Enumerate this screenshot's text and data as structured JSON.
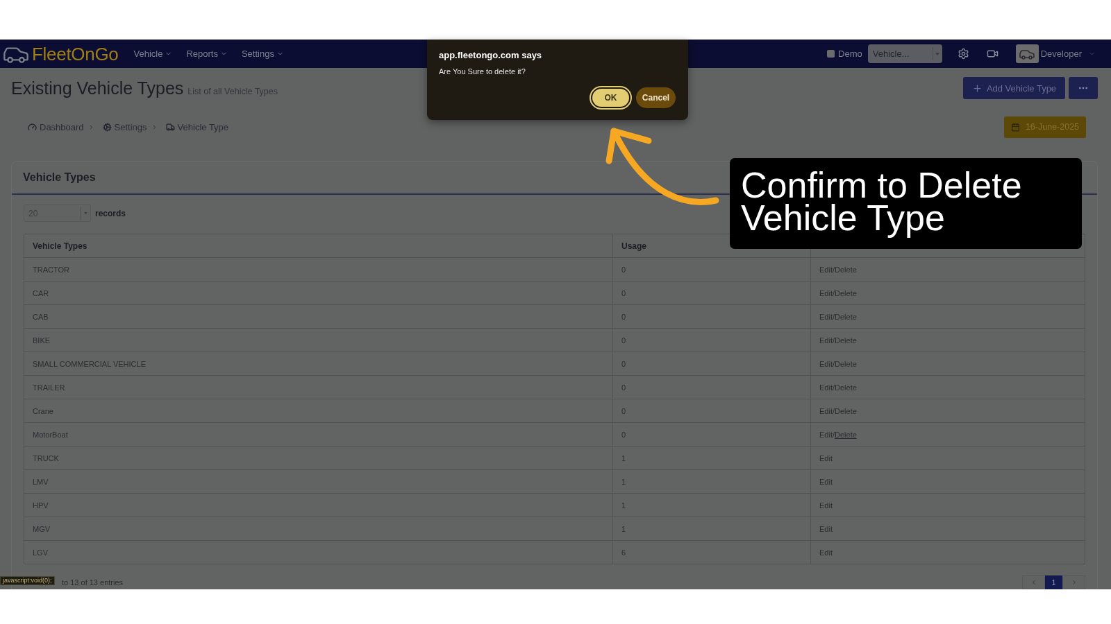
{
  "nav": {
    "logo": "FleetOnGo",
    "menu": [
      {
        "label": "Vehicle"
      },
      {
        "label": "Reports"
      },
      {
        "label": "Settings"
      }
    ],
    "demo": {
      "label": "Demo",
      "checked": false
    },
    "vehicle_select": {
      "value": "Vehicle..."
    },
    "user": {
      "name": "Developer"
    }
  },
  "header": {
    "title": "Existing Vehicle Types",
    "subtitle": "List of all Vehicle Types",
    "add_button": "Add Vehicle Type"
  },
  "breadcrumb": [
    {
      "kind": "dashboard",
      "label": "Dashboard"
    },
    {
      "kind": "settings",
      "label": "Settings"
    },
    {
      "kind": "vehicle",
      "label": "Vehicle Type"
    }
  ],
  "date_button": "16-June-2025",
  "section": {
    "title": "Vehicle Types",
    "page_size": "20",
    "page_size_label": "records"
  },
  "table": {
    "columns": [
      "Vehicle Types",
      "Usage"
    ],
    "rows": [
      {
        "name": "TRACTOR",
        "usage": "0",
        "separator": "/",
        "actions": [
          {
            "label": "Edit",
            "hovered": false
          },
          {
            "label": "Delete",
            "hovered": false
          }
        ]
      },
      {
        "name": "CAR",
        "usage": "0",
        "separator": "/",
        "actions": [
          {
            "label": "Edit",
            "hovered": false
          },
          {
            "label": "Delete",
            "hovered": false
          }
        ]
      },
      {
        "name": "CAB",
        "usage": "0",
        "separator": "/",
        "actions": [
          {
            "label": "Edit",
            "hovered": false
          },
          {
            "label": "Delete",
            "hovered": false
          }
        ]
      },
      {
        "name": "BIKE",
        "usage": "0",
        "separator": "/",
        "actions": [
          {
            "label": "Edit",
            "hovered": false
          },
          {
            "label": "Delete",
            "hovered": false
          }
        ]
      },
      {
        "name": "SMALL COMMERCIAL VEHICLE",
        "usage": "0",
        "separator": "/",
        "actions": [
          {
            "label": "Edit",
            "hovered": false
          },
          {
            "label": "Delete",
            "hovered": false
          }
        ]
      },
      {
        "name": "TRAILER",
        "usage": "0",
        "separator": "/",
        "actions": [
          {
            "label": "Edit",
            "hovered": false
          },
          {
            "label": "Delete",
            "hovered": false
          }
        ]
      },
      {
        "name": "Crane",
        "usage": "0",
        "separator": "/",
        "actions": [
          {
            "label": "Edit",
            "hovered": false
          },
          {
            "label": "Delete",
            "hovered": false
          }
        ]
      },
      {
        "name": "MotorBoat",
        "usage": "0",
        "separator": "/",
        "actions": [
          {
            "label": "Edit",
            "hovered": false
          },
          {
            "label": "Delete",
            "hovered": true
          }
        ]
      },
      {
        "name": "TRUCK",
        "usage": "1",
        "actions": [
          {
            "label": "Edit",
            "hovered": false
          }
        ]
      },
      {
        "name": "LMV",
        "usage": "1",
        "actions": [
          {
            "label": "Edit",
            "hovered": false
          }
        ]
      },
      {
        "name": "HPV",
        "usage": "1",
        "actions": [
          {
            "label": "Edit",
            "hovered": false
          }
        ]
      },
      {
        "name": "MGV",
        "usage": "1",
        "actions": [
          {
            "label": "Edit",
            "hovered": false
          }
        ]
      },
      {
        "name": "LGV",
        "usage": "6",
        "actions": [
          {
            "label": "Edit",
            "hovered": false
          }
        ]
      }
    ]
  },
  "footer": {
    "info": "to 13 of 13 entries",
    "pages": [
      {
        "label": "1",
        "selected": true
      }
    ]
  },
  "status_bar": {
    "url": "javascript:void(0);"
  },
  "dialog": {
    "title": "app.fleetongo.com says",
    "message": "Are You Sure to delete it?",
    "buttons": [
      {
        "label": "OK",
        "kind": "primary",
        "focused": true
      },
      {
        "label": "Cancel",
        "kind": "secondary",
        "focused": false
      }
    ]
  },
  "annotation": {
    "callout": "Confirm to Delete Vehicle Type"
  }
}
